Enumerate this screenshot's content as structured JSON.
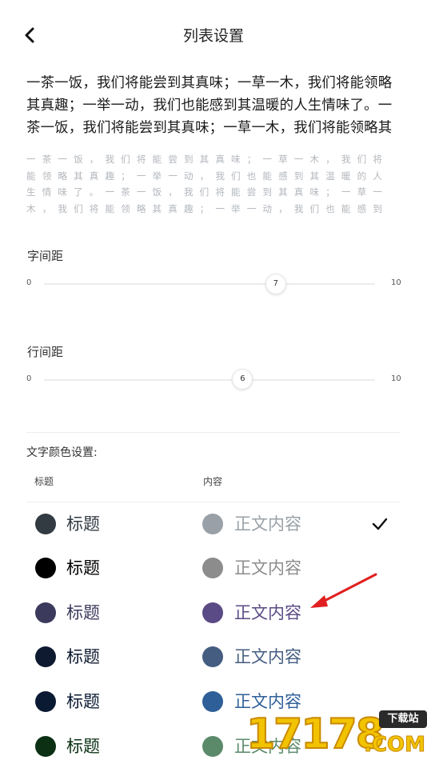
{
  "header": {
    "title": "列表设置",
    "back_icon": "chevron-left-icon"
  },
  "preview": {
    "title_text": "一茶一饭，我们将能尝到其真味；一草一木，我们将能领略其真趣；一举一动，我们也能感到其温暖的人生情味了。一茶一饭，我们将能尝到其真味；一草一木，我们将能领略其",
    "content_text": "一茶一饭，我们将能尝到其真味；一草一木，我们将能领略其真趣；一举一动，我们也能感到其温暖的人生情味了。一茶一饭，我们将能尝到其真味；一草一木，我们将能领略其真趣；一举一动，我们也能感到"
  },
  "letter_spacing": {
    "label": "字间距",
    "min": "0",
    "max": "10",
    "value": "7",
    "fraction": 0.7
  },
  "line_spacing": {
    "label": "行间距",
    "min": "0",
    "max": "10",
    "value": "6",
    "fraction": 0.6
  },
  "color_settings": {
    "title": "文字颜色设置:",
    "title_column": "标题",
    "content_column": "内容",
    "options": [
      {
        "title": "标题",
        "content": "正文内容",
        "title_color": "#323a42",
        "content_color": "#9aa0a8",
        "selected": true
      },
      {
        "title": "标题",
        "content": "正文内容",
        "title_color": "#000000",
        "content_color": "#8c8c8c",
        "selected": false
      },
      {
        "title": "标题",
        "content": "正文内容",
        "title_color": "#3b3a5c",
        "content_color": "#5a4a85",
        "selected": false
      },
      {
        "title": "标题",
        "content": "正文内容",
        "title_color": "#0e1a30",
        "content_color": "#445d80",
        "selected": false
      },
      {
        "title": "标题",
        "content": "正文内容",
        "title_color": "#0b1a33",
        "content_color": "#2e5f98",
        "selected": false
      },
      {
        "title": "标题",
        "content": "正文内容",
        "title_color": "#0b3013",
        "content_color": "#5a8a6a",
        "selected": false
      }
    ]
  },
  "watermark": {
    "digits": "17178",
    "tag": "下载站",
    "suffix": ".COM"
  }
}
